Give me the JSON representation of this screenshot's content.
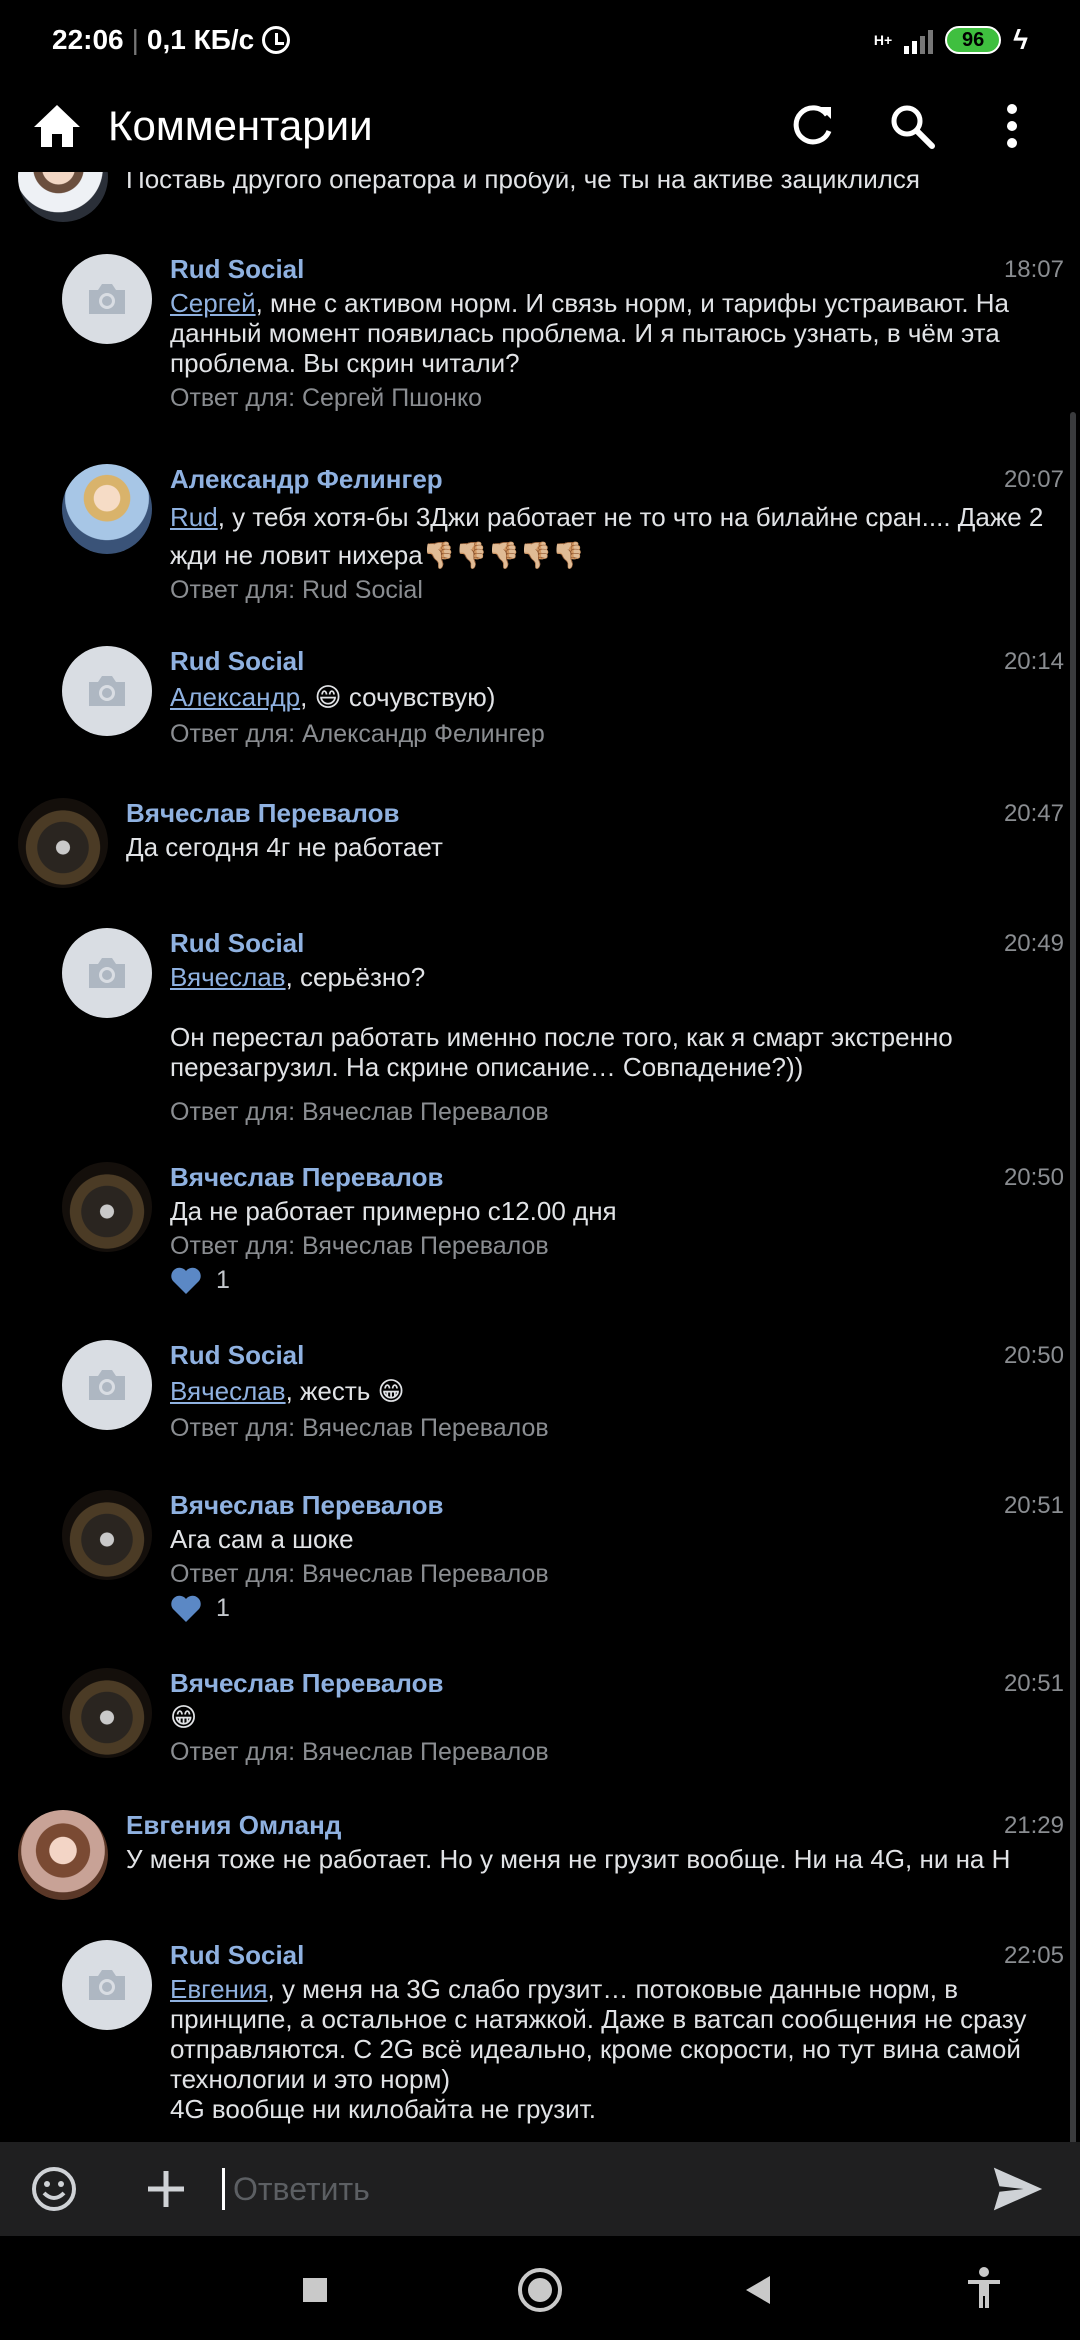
{
  "status_bar": {
    "time": "22:06",
    "speed": "0,1 КБ/с",
    "network": "H+",
    "battery": "96"
  },
  "app_bar": {
    "title": "Комментарии",
    "icons": [
      "home-icon",
      "refresh-icon",
      "search-icon",
      "more-vert-icon"
    ]
  },
  "comments": [
    {
      "author": "",
      "time": "",
      "text": "Поставь другого оператора и пробуй, че ты на активе зациклился",
      "reply_to": ""
    },
    {
      "author": "Rud Social",
      "time": "18:07",
      "mention": "Сергей",
      "text": ", мне с активом норм. И связь норм, и тарифы устраивают. На данный момент появилась проблема. И я пытаюсь узнать, в чём эта проблема. Вы скрин читали?",
      "reply_to": "Ответ для: Сергей Пшонко"
    },
    {
      "author": "Александр Фелингер",
      "time": "20:07",
      "mention": "Rud",
      "text": ", у тебя хотя-бы 3Джи работает не то что на билайне сран.... Даже 2 жди не ловит нихера",
      "emoji": "👎🏼👎🏼👎🏼👎🏼👎🏼",
      "reply_to": "Ответ для: Rud Social"
    },
    {
      "author": "Rud Social",
      "time": "20:14",
      "mention": "Александр",
      "text": ", 😄 сочувствую)",
      "reply_to": "Ответ для: Александр Фелингер"
    },
    {
      "author": "Вячеслав Перевалов",
      "time": "20:47",
      "text": "Да сегодня 4г не работает",
      "reply_to": ""
    },
    {
      "author": "Rud Social",
      "time": "20:49",
      "mention": "Вячеслав",
      "text": ", серьёзно?",
      "text2": "Он перестал работать именно после того, как я смарт экстренно перезагрузил. На скрине описание… Совпадение?))",
      "reply_to": "Ответ для: Вячеслав Перевалов"
    },
    {
      "author": "Вячеслав Перевалов",
      "time": "20:50",
      "text": "Да не работает примерно с12.00 дня",
      "reply_to": "Ответ для: Вячеслав Перевалов",
      "likes": "1"
    },
    {
      "author": "Rud Social",
      "time": "20:50",
      "mention": "Вячеслав",
      "text": ", жесть 😁",
      "reply_to": "Ответ для: Вячеслав Перевалов"
    },
    {
      "author": "Вячеслав Перевалов",
      "time": "20:51",
      "text": "Ага сам а шоке",
      "reply_to": "Ответ для: Вячеслав Перевалов",
      "likes": "1"
    },
    {
      "author": "Вячеслав Перевалов",
      "time": "20:51",
      "text": "😁",
      "reply_to": "Ответ для: Вячеслав Перевалов"
    },
    {
      "author": "Евгения Омланд",
      "time": "21:29",
      "text": "У меня тоже не работает. Но у меня не грузит вообще. Ни на 4G, ни на H",
      "reply_to": ""
    },
    {
      "author": "Rud Social",
      "time": "22:05",
      "mention": "Евгения",
      "text": ", у меня на 3G слабо грузит… потоковые данные норм, в принципе, а остальное с натяжкой. Даже в ватсап сообщения не сразу отправляются. С 2G всё идеально, кроме скорости, но тут вина самой технологии и это норм)\n4G вообще ни килобайта не грузит.",
      "reply_to": ""
    }
  ],
  "input_bar": {
    "placeholder": "Ответить"
  },
  "colors": {
    "background": "#000000",
    "author": "#8fb1e0",
    "secondary": "#8a8d91",
    "like": "#5b88c5"
  }
}
